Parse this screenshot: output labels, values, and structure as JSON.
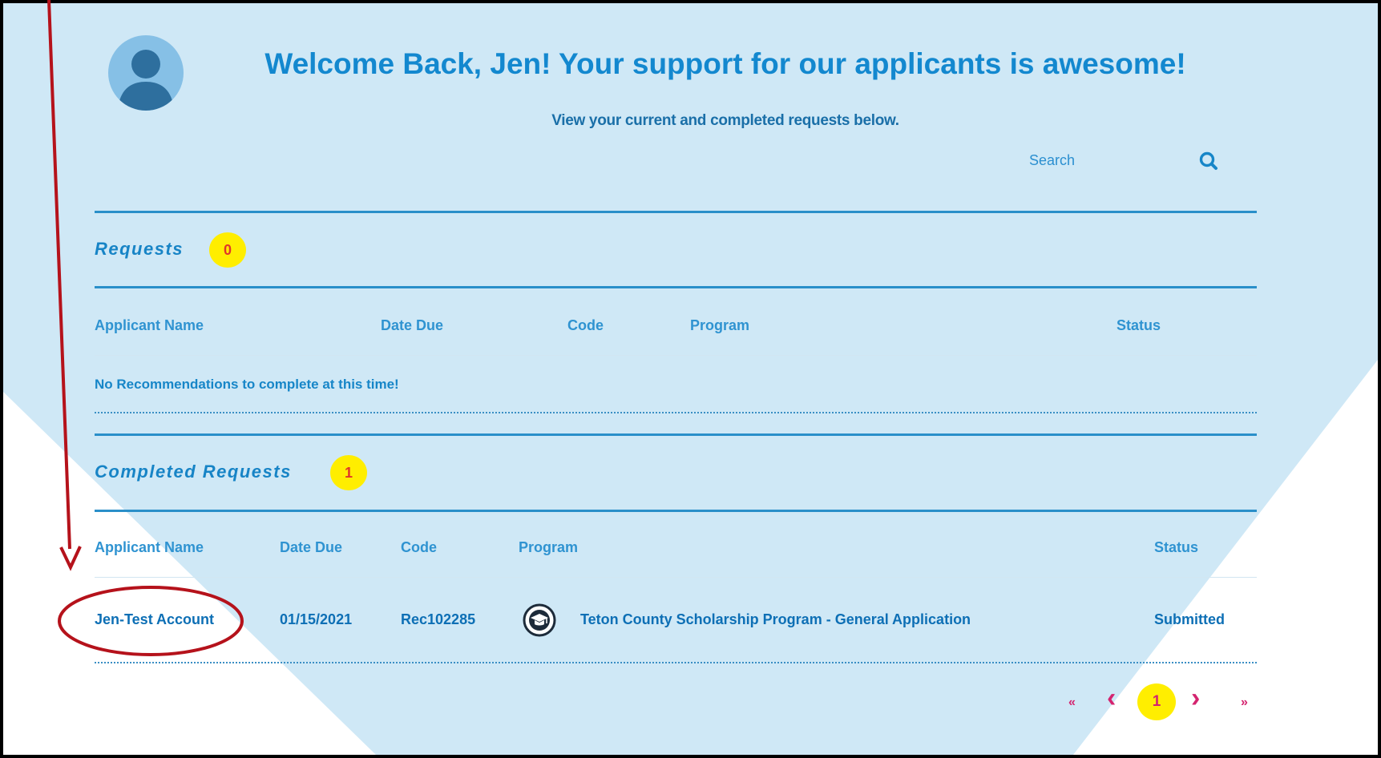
{
  "header": {
    "welcome": "Welcome Back, Jen! Your support for our applicants is awesome!",
    "subtitle": "View your current and completed requests below."
  },
  "search": {
    "label": "Search",
    "icon": "search-icon"
  },
  "requests": {
    "title": "Requests",
    "count": "0",
    "columns": [
      "Applicant Name",
      "Date Due",
      "Code",
      "Program",
      "Status"
    ],
    "empty_message": "No Recommendations to complete at this time!"
  },
  "completed": {
    "title": "Completed Requests",
    "count": "1",
    "columns": [
      "Applicant Name",
      "Date Due",
      "Code",
      "Program",
      "Status"
    ],
    "rows": [
      {
        "applicant": "Jen-Test Account",
        "date_due": "01/15/2021",
        "code": "Rec102285",
        "program_icon": "graduation-cap-icon",
        "program": "Teton County Scholarship Program - General Application",
        "status": "Submitted"
      }
    ]
  },
  "pagination": {
    "first": "«",
    "prev": "‹",
    "current": "1",
    "next": "›",
    "last": "»"
  },
  "colors": {
    "background_shape": "#cfe8f6",
    "accent_blue": "#1388cf",
    "badge_yellow": "#ffee00",
    "badge_text": "#e0372a",
    "pager_pink": "#d4246f",
    "annotation_red": "#b5121b"
  }
}
